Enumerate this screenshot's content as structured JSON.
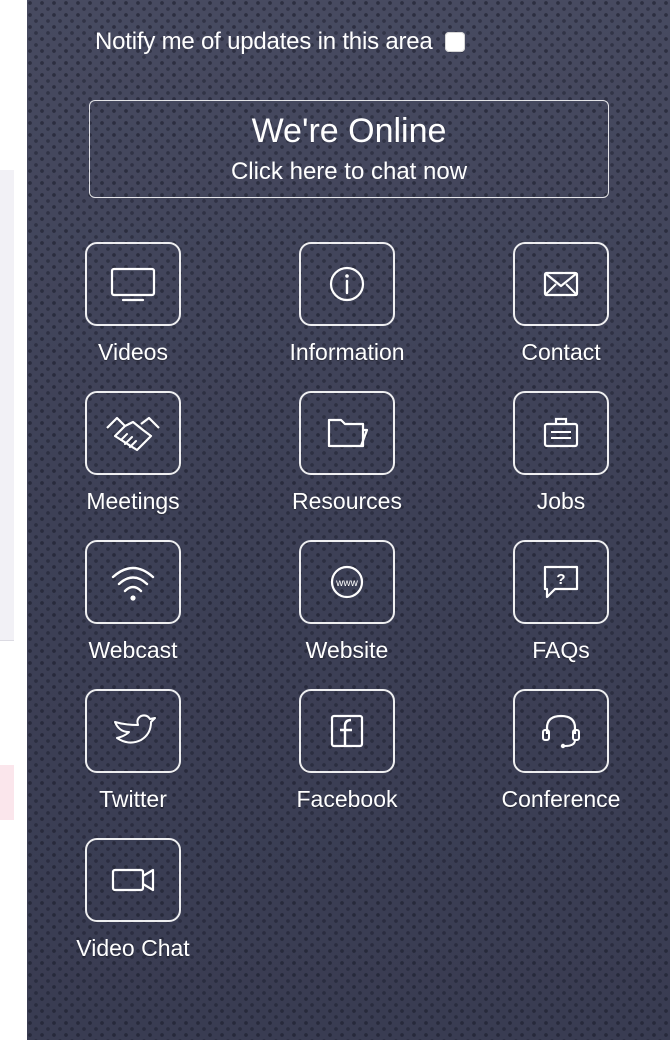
{
  "notify": {
    "label": "Notify me of updates in this area",
    "checked": false
  },
  "chat": {
    "title": "We're Online",
    "subtitle": "Click here to chat now"
  },
  "tiles": [
    {
      "label": "Videos",
      "icon": "monitor-icon"
    },
    {
      "label": "Information",
      "icon": "info-icon"
    },
    {
      "label": "Contact",
      "icon": "envelope-icon"
    },
    {
      "label": "Meetings",
      "icon": "handshake-icon"
    },
    {
      "label": "Resources",
      "icon": "folder-icon"
    },
    {
      "label": "Jobs",
      "icon": "briefcase-icon"
    },
    {
      "label": "Webcast",
      "icon": "wifi-icon"
    },
    {
      "label": "Website",
      "icon": "www-icon"
    },
    {
      "label": "FAQs",
      "icon": "question-bubble-icon"
    },
    {
      "label": "Twitter",
      "icon": "twitter-icon"
    },
    {
      "label": "Facebook",
      "icon": "facebook-icon"
    },
    {
      "label": "Conference",
      "icon": "headset-icon"
    },
    {
      "label": "Video Chat",
      "icon": "video-camera-icon"
    }
  ]
}
